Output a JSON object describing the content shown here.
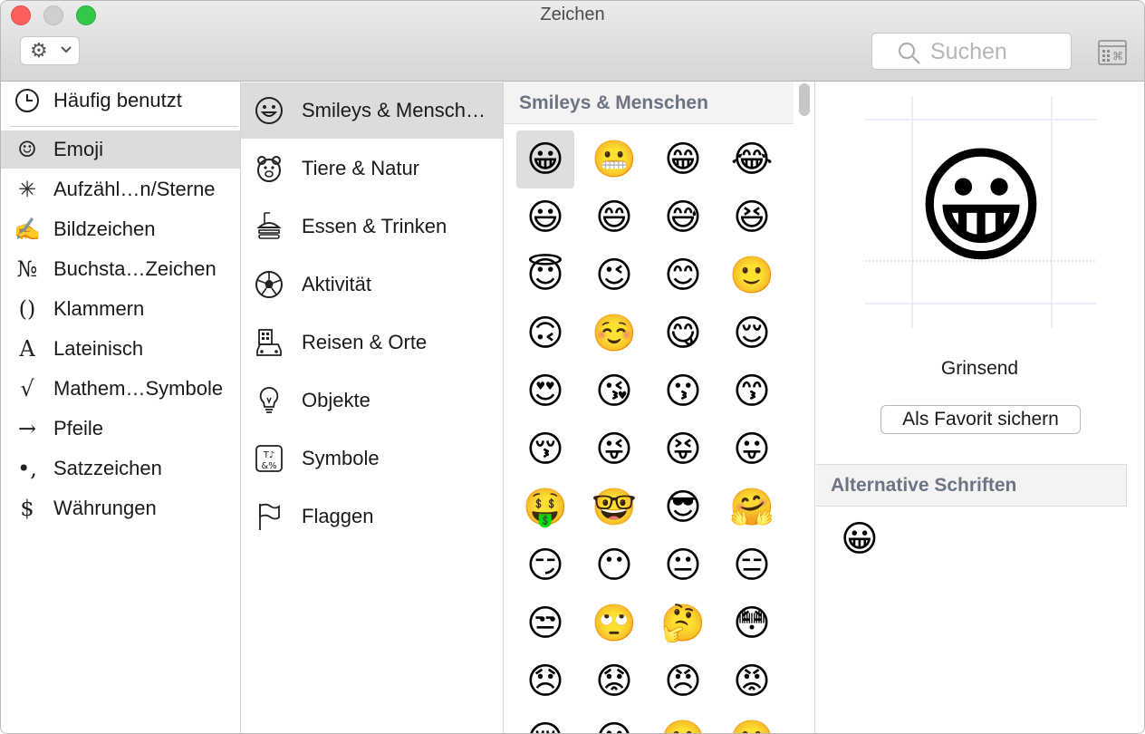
{
  "window": {
    "title": "Zeichen"
  },
  "toolbar": {
    "gear_icon": "gear-icon",
    "search_placeholder": "Suchen"
  },
  "categories": [
    {
      "icon": "clock-icon",
      "glyph": "",
      "label": "Häufig benutzt"
    },
    {
      "icon": "smiley-outline-icon",
      "glyph": "☺",
      "label": "Emoji",
      "selected": true
    },
    {
      "icon": "asterisk-icon",
      "glyph": "✳",
      "label": "Aufzähl…n/Sterne"
    },
    {
      "icon": "writing-hand-icon",
      "glyph": "✍",
      "label": "Bildzeichen"
    },
    {
      "icon": "numero-icon",
      "glyph": "№",
      "label": "Buchsta…Zeichen"
    },
    {
      "icon": "parentheses-icon",
      "glyph": "()",
      "label": "Klammern"
    },
    {
      "icon": "latin-a-icon",
      "glyph": "A",
      "label": "Lateinisch"
    },
    {
      "icon": "square-root-icon",
      "glyph": "√",
      "label": "Mathem…Symbole"
    },
    {
      "icon": "arrow-right-icon",
      "glyph": "→",
      "label": "Pfeile"
    },
    {
      "icon": "punctuation-icon",
      "glyph": "•,",
      "label": "Satzzeichen"
    },
    {
      "icon": "dollar-icon",
      "glyph": "$",
      "label": "Währungen"
    }
  ],
  "subcategories": [
    {
      "icon": "smiley-outline-icon",
      "label": "Smileys & Mensch…",
      "selected": true
    },
    {
      "icon": "bear-icon",
      "label": "Tiere & Natur"
    },
    {
      "icon": "burger-cup-icon",
      "label": "Essen & Trinken"
    },
    {
      "icon": "soccer-ball-icon",
      "label": "Aktivität"
    },
    {
      "icon": "building-car-icon",
      "label": "Reisen & Orte"
    },
    {
      "icon": "lightbulb-icon",
      "label": "Objekte"
    },
    {
      "icon": "symbols-icon",
      "label": "Symbole"
    },
    {
      "icon": "flag-icon",
      "label": "Flaggen"
    }
  ],
  "emoji_panel": {
    "header": "Smileys & Menschen",
    "emojis": [
      "😀",
      "😬",
      "😁",
      "😂",
      "😃",
      "😄",
      "😅",
      "😆",
      "😇",
      "😉",
      "😊",
      "🙂",
      "🙃",
      "☺️",
      "😋",
      "😌",
      "😍",
      "😘",
      "😗",
      "😙",
      "😚",
      "😜",
      "😝",
      "😛",
      "🤑",
      "🤓",
      "😎",
      "🤗",
      "😏",
      "😶",
      "😐",
      "😑",
      "😒",
      "🙄",
      "🤔",
      "😳",
      "😞",
      "😟",
      "😠",
      "😡",
      "😔",
      "😕",
      "🙁",
      "☹️"
    ],
    "selected_index": 0
  },
  "detail": {
    "emoji_name": "Grinsend",
    "favorite_button": "Als Favorit sichern",
    "alt_header": "Alternative Schriften",
    "alt_emoji": "😀"
  }
}
